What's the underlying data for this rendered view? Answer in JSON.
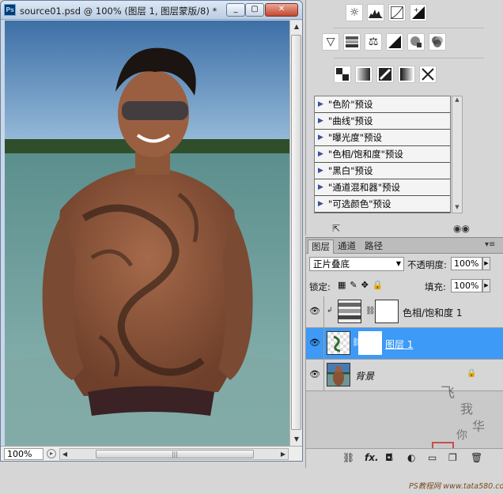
{
  "window": {
    "title": "source01.psd @ 100% (图层 1, 图层蒙版/8) *",
    "logo_text": "Ps",
    "buttons": {
      "minimize": "_",
      "maximize": "▢",
      "close": "✕"
    }
  },
  "status_bar": {
    "zoom": "100%"
  },
  "adjustments": {
    "row1_icons": [
      "brightness-icon",
      "levels-icon",
      "curves-icon",
      "exposure-icon"
    ],
    "row2_icons": [
      "vibrance-icon",
      "hue-saturation-icon",
      "color-balance-icon",
      "black-white-icon",
      "photo-filter-icon",
      "channel-mixer-icon"
    ],
    "row3_icons": [
      "invert-icon",
      "posterize-icon",
      "threshold-icon",
      "gradient-map-icon",
      "selective-color-icon"
    ],
    "presets": [
      "\"色阶\"预设",
      "\"曲线\"预设",
      "\"曝光度\"预设",
      "\"色相/饱和度\"预设",
      "\"黑白\"预设",
      "\"通道混和器\"预设",
      "\"可选颜色\"预设"
    ],
    "footer_left_icon": "return-to-list-icon",
    "footer_right_icon": "clip-to-layer-icon"
  },
  "layers": {
    "tabs": [
      "图层",
      "通道",
      "路径"
    ],
    "active_tab": "图层",
    "blend_mode": "正片叠底",
    "opacity_label": "不透明度:",
    "opacity_value": "100%",
    "lock_label": "锁定:",
    "fill_label": "填充:",
    "fill_value": "100%",
    "items": [
      {
        "name": "色相/饱和度 1",
        "selected": false,
        "type": "adjustment"
      },
      {
        "name": "图层 1",
        "selected": true,
        "type": "pixel"
      },
      {
        "name": "背景",
        "selected": false,
        "type": "background",
        "locked": true
      }
    ],
    "watermark_text": "PS教程网 www.tata580.com",
    "bottom_icons": [
      "link-icon",
      "fx-icon",
      "add-mask-icon",
      "adjustment-layer-icon",
      "group-icon",
      "new-layer-icon",
      "trash-icon"
    ]
  },
  "colors": {
    "selected_layer": "#3d9af6",
    "panel_bg": "#d6d6d6"
  }
}
